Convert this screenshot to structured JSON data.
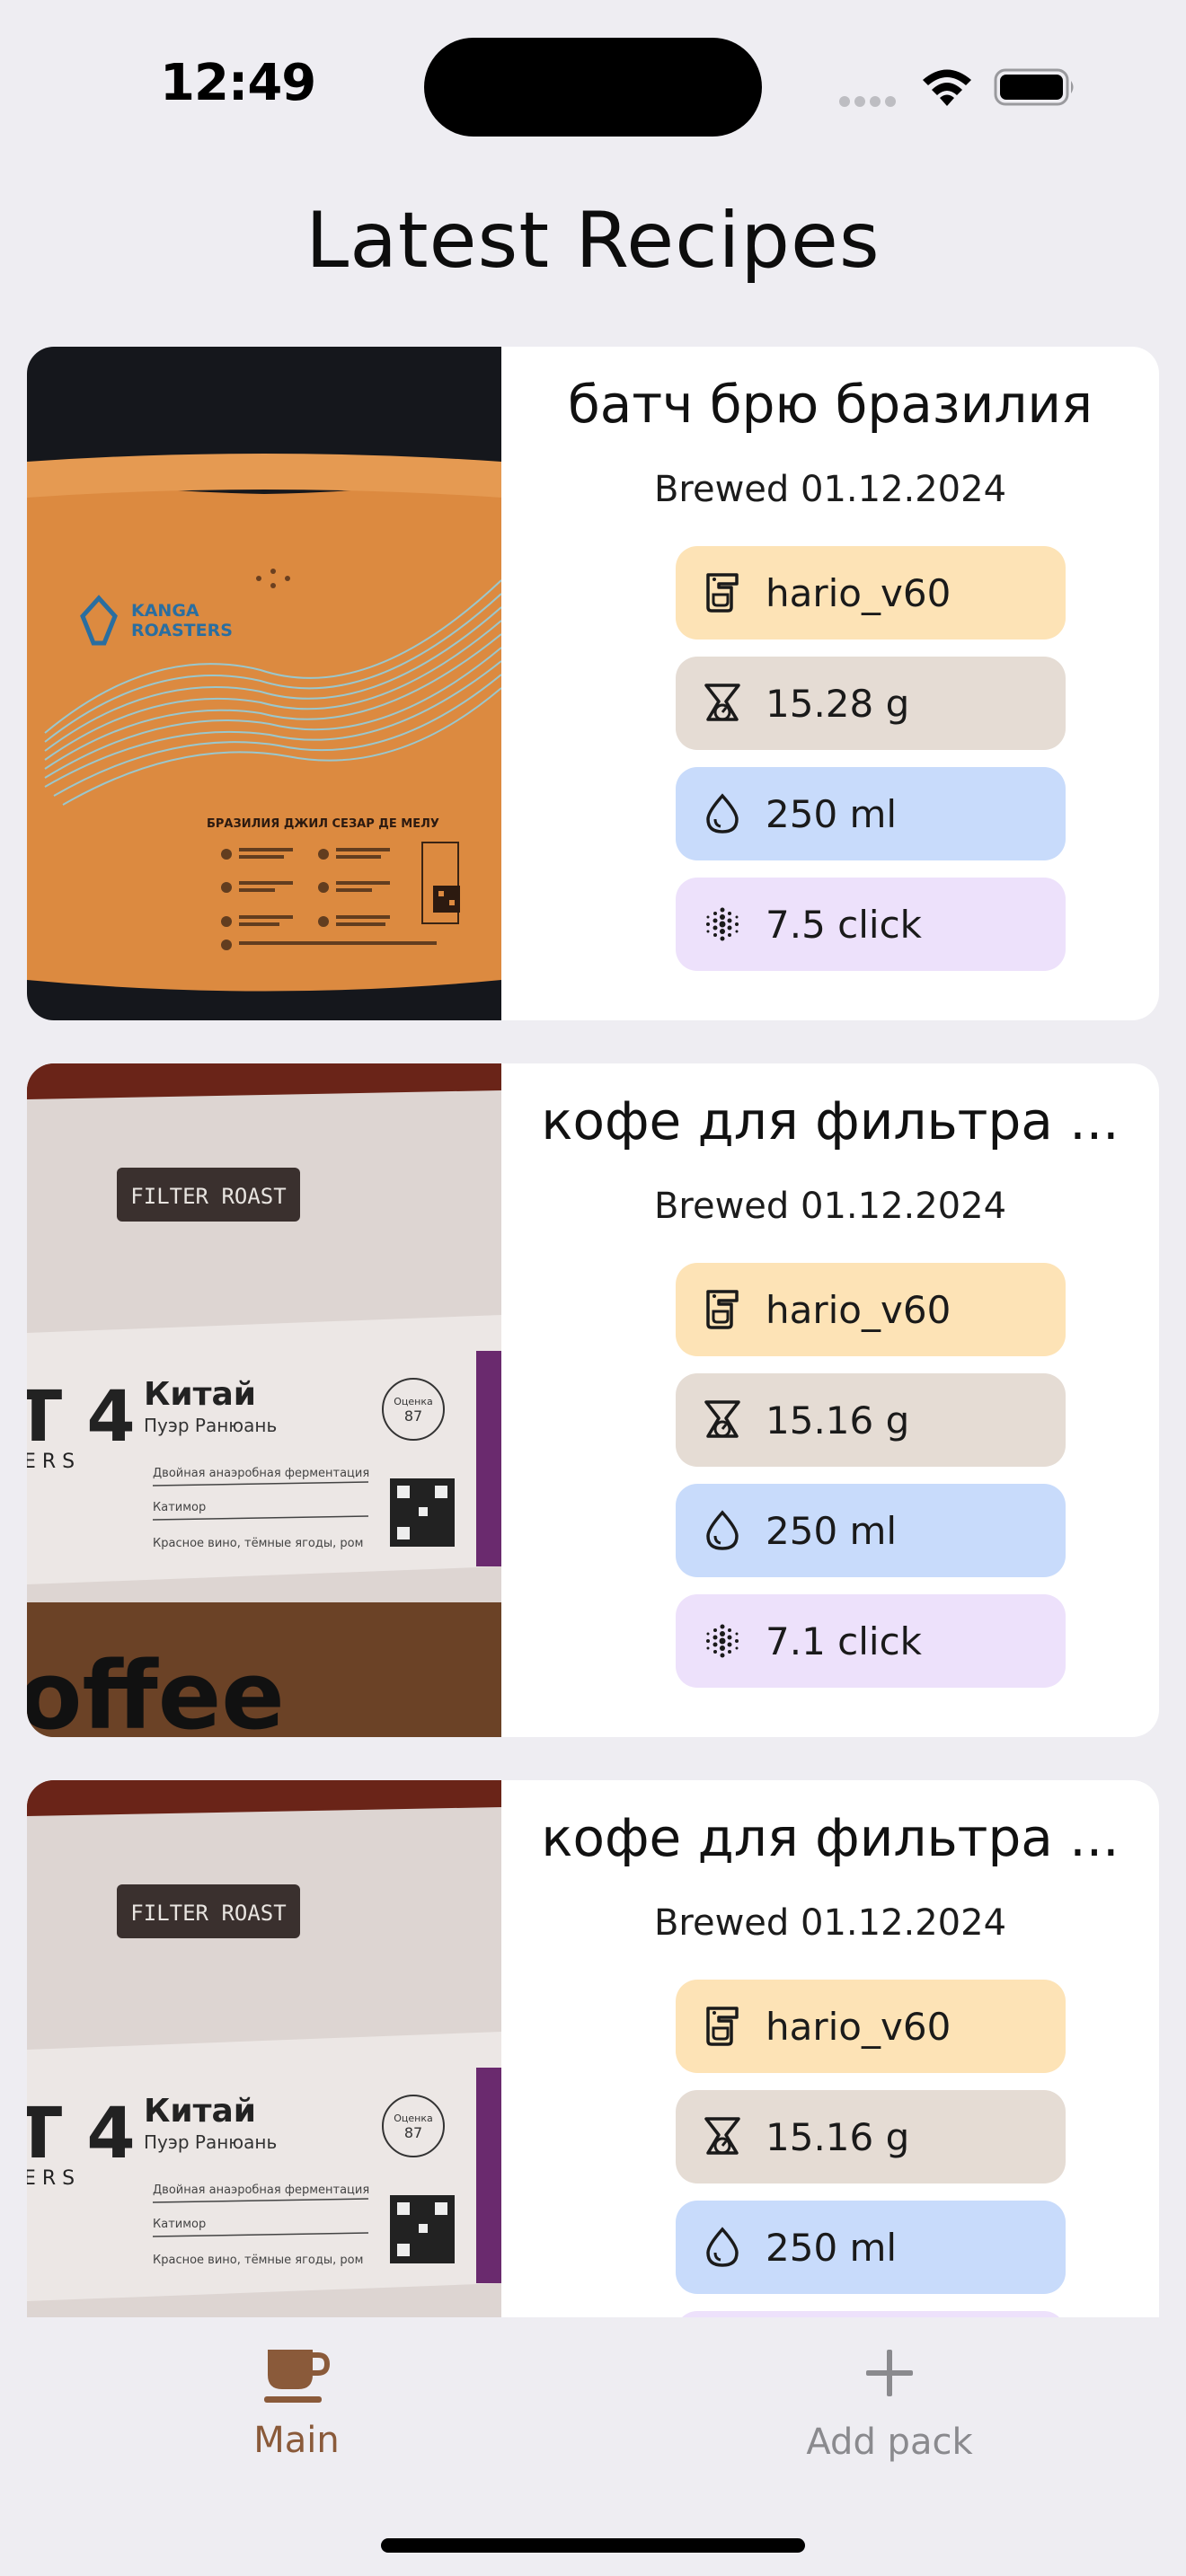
{
  "status_bar": {
    "time": "12:49"
  },
  "header": {
    "title": "Latest Recipes"
  },
  "recipes": [
    {
      "title": "батч брю бразилия",
      "date": "Brewed 01.12.2024",
      "brewer": "hario_v60",
      "dose": "15.28 g",
      "water": "250 ml",
      "grind": "7.5 click",
      "photo": {
        "label_brand": "KANGA ROASTERS",
        "label_text": "БРАЗИЛИЯ ДЖИЛ СЕЗАР ДЕ МЕЛУ"
      }
    },
    {
      "title": "кофе для фильтра ...",
      "date": "Brewed 01.12.2024",
      "brewer": "hario_v60",
      "dose": "15.16 g",
      "water": "250 ml",
      "grind": "7.1 click",
      "photo": {
        "tag": "FILTER ROAST",
        "origin": "Китай",
        "region": "Пуэр Ранюань",
        "line1": "Двойная анаэробная ферментация",
        "line2": "Катимор",
        "line3": "Красное вино, тёмные ягоды, ром",
        "score_label": "Оценка",
        "score": "87",
        "big_text": "offee",
        "side_text": "T 4",
        "side_small": "E R S"
      }
    },
    {
      "title": "кофе для фильтра ...",
      "date": "Brewed 01.12.2024",
      "brewer": "hario_v60",
      "dose": "15.16 g",
      "water": "250 ml",
      "photo": {
        "tag": "FILTER ROAST",
        "origin": "Китай",
        "region": "Пуэр Ранюань",
        "line1": "Двойная анаэробная ферментация",
        "line2": "Катимор",
        "line3": "Красное вино, тёмные ягоды, ром",
        "score_label": "Оценка",
        "score": "87",
        "side_text": "T 4",
        "side_small": "E R S"
      }
    }
  ],
  "tab_bar": {
    "main_label": "Main",
    "add_label": "Add pack"
  },
  "icons": {
    "brewer": "coffee-maker-icon",
    "dose": "scale-icon",
    "water": "water-drop-icon",
    "grind": "grind-dots-icon",
    "main": "coffee-cup-icon",
    "add": "plus-icon"
  },
  "colors": {
    "brewer_chip": "#fde3b6",
    "dose_chip": "#e5dcd4",
    "water_chip": "#c8dbfb",
    "grind_chip": "#ede1fb",
    "active_tab": "#8a5a3a",
    "inactive_tab": "#8a8a8e"
  }
}
